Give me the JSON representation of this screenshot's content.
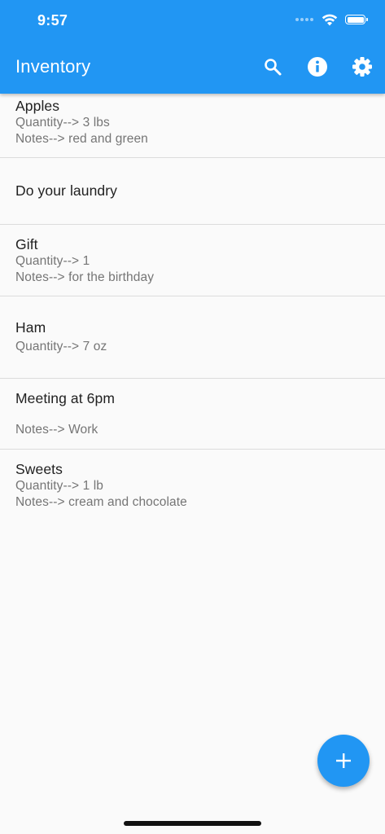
{
  "status_bar": {
    "time": "9:57"
  },
  "app_bar": {
    "title": "Inventory",
    "background_color": "#2196f3",
    "actions": [
      {
        "icon": "search-icon"
      },
      {
        "icon": "info-icon"
      },
      {
        "icon": "gear-icon"
      }
    ]
  },
  "items": [
    {
      "title": "Apples",
      "quantity": "Quantity--> 3 lbs",
      "notes": "Notes--> red and green"
    },
    {
      "title": "Do your laundry",
      "quantity": "",
      "notes": ""
    },
    {
      "title": "Gift",
      "quantity": "Quantity--> 1",
      "notes": "Notes--> for the birthday"
    },
    {
      "title": "Ham",
      "quantity": "Quantity--> 7 oz",
      "notes": ""
    },
    {
      "title": "Meeting at 6pm",
      "quantity": "",
      "notes": "Notes--> Work"
    },
    {
      "title": "Sweets",
      "quantity": "Quantity--> 1 lb",
      "notes": "Notes--> cream and chocolate"
    }
  ],
  "fab": {
    "icon": "plus-icon"
  }
}
